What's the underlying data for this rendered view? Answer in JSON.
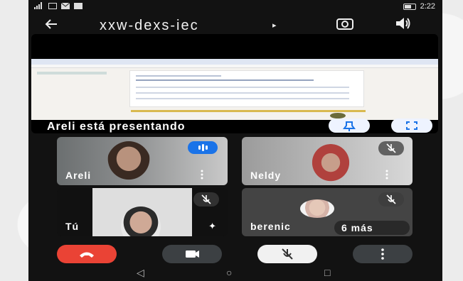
{
  "status_bar": {
    "time": "2:22"
  },
  "header": {
    "title": "xxw-dexs-iec",
    "back_icon": "arrow-left-icon",
    "caret_icon": "caret-right-icon",
    "switch_camera_icon": "camera-switch-icon",
    "speaker_icon": "speaker-icon"
  },
  "presentation": {
    "label": "Areli está presentando",
    "pin_icon": "pin-icon",
    "fullscreen_icon": "fullscreen-icon"
  },
  "participants": [
    {
      "name": "Areli",
      "speaking": true
    },
    {
      "name": "Neldy",
      "muted": true
    },
    {
      "name": "Tú",
      "muted": true
    },
    {
      "name": "berenic",
      "muted": true,
      "more_label": "6 más"
    }
  ],
  "controls": {
    "end_call_icon": "end-call-icon",
    "video_icon": "video-camera-icon",
    "mic_icon": "mic-off-icon",
    "more_icon": "more-vertical-icon"
  },
  "nav": {
    "back": "◁",
    "home": "○",
    "recents": "□"
  },
  "colors": {
    "background": "#121212",
    "end_call": "#ea4335",
    "speaking_badge": "#1a73e8",
    "control_dark": "#3c4043",
    "control_light": "#f1f1f1"
  }
}
